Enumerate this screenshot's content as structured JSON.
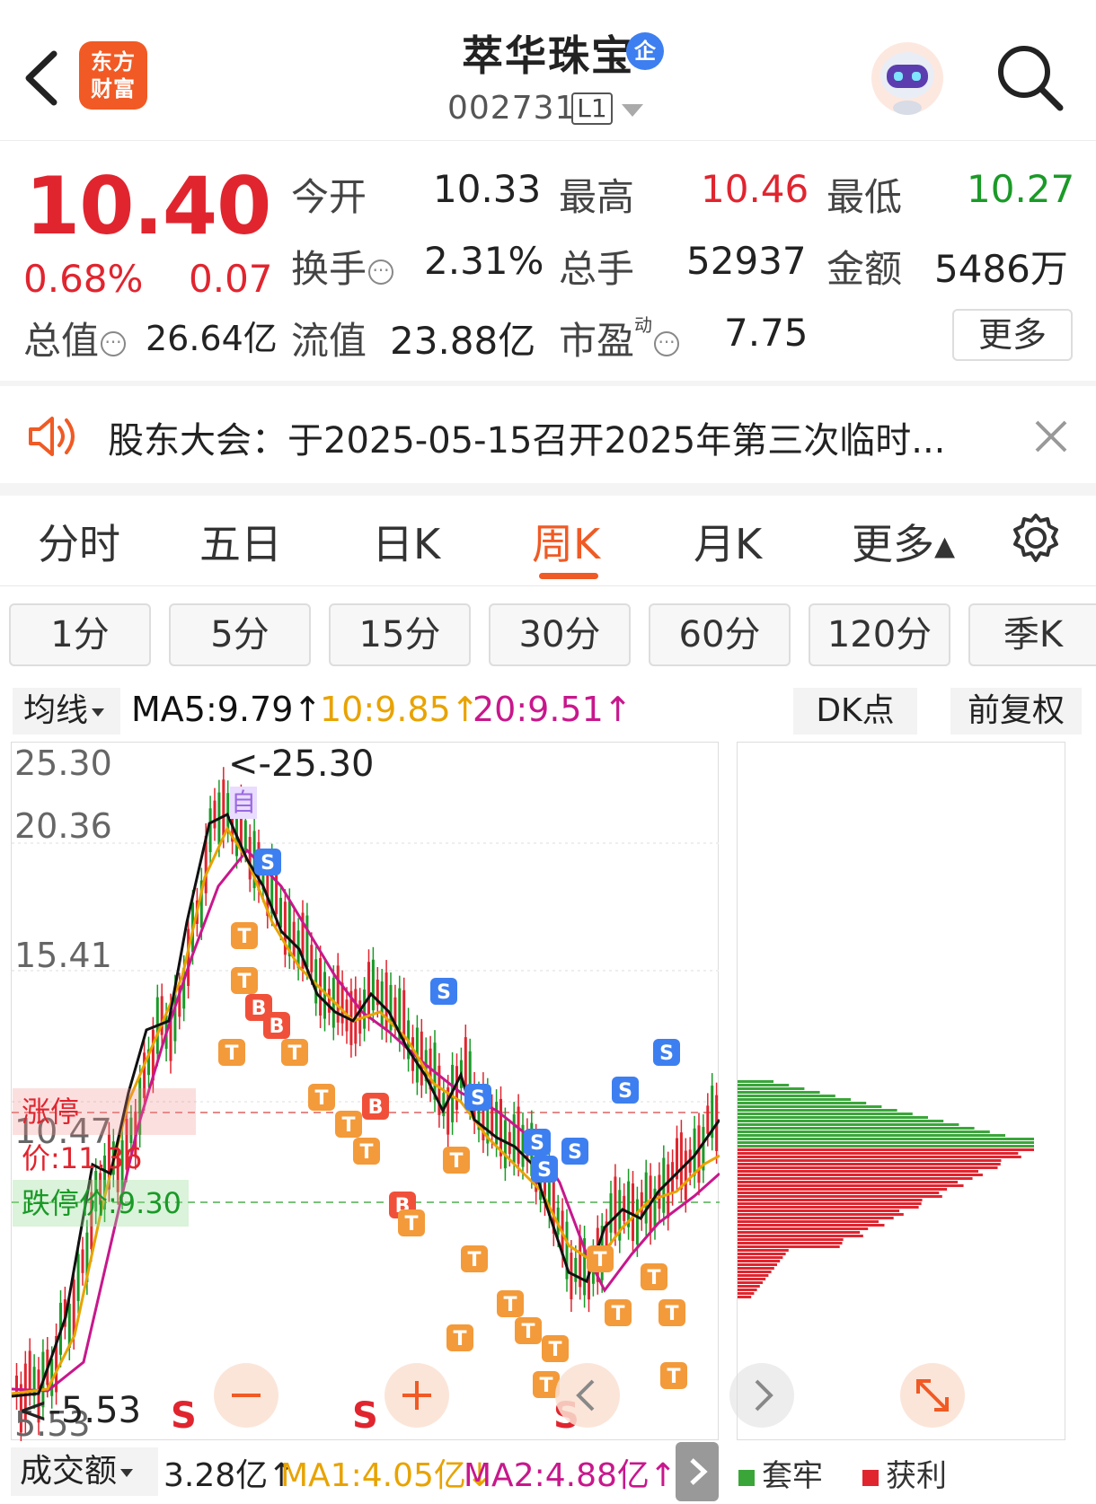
{
  "header": {
    "logo_text_line1": "东方",
    "logo_text_line2": "财富",
    "title": "萃华珠宝",
    "badge": "企",
    "code": "002731",
    "level": "L1"
  },
  "quote": {
    "price": "10.40",
    "change_pct": "0.68%",
    "change_val": "0.07",
    "open_label": "今开",
    "open": "10.33",
    "high_label": "最高",
    "high": "10.46",
    "low_label": "最低",
    "low": "10.27",
    "turnover_label": "换手",
    "turnover": "2.31%",
    "volume_label": "总手",
    "volume": "52937",
    "amount_label": "金额",
    "amount": "5486万",
    "mktcap_label": "总值",
    "mktcap": "26.64亿",
    "float_label": "流值",
    "float_cap": "23.88亿",
    "pe_label": "市盈",
    "pe_sup": "动",
    "pe": "7.75",
    "more_label": "更多"
  },
  "notice": {
    "text": "股东大会：于2025-05-15召开2025年第三次临时..."
  },
  "tabs": [
    {
      "label": "分时"
    },
    {
      "label": "五日"
    },
    {
      "label": "日K"
    },
    {
      "label": "周K"
    },
    {
      "label": "月K"
    },
    {
      "label": "更多▴"
    }
  ],
  "periods": [
    "1分",
    "5分",
    "15分",
    "30分",
    "60分",
    "120分",
    "季K"
  ],
  "ma_row": {
    "selector": "均线",
    "ma5": "MA5:9.79↑",
    "ma10": "10:9.85↑",
    "ma20": "20:9.51↑",
    "dk": "DK点",
    "adjust": "前复权"
  },
  "chart": {
    "y_labels": [
      "25.30",
      "20.36",
      "15.41",
      "10.47",
      "5.53"
    ],
    "limit_up": "涨停价:11.36",
    "limit_down": "跌停价:9.30",
    "max_marker": "<-25.30",
    "min_marker": "<-5.53",
    "self_tag": "自",
    "s_label": "S"
  },
  "volume_row": {
    "selector": "成交额",
    "vol": "3.28亿↑",
    "ma1": "MA1:4.05亿↓",
    "ma2": "MA2:4.88亿↑"
  },
  "legend": {
    "trapped": "套牢",
    "profit": "获利"
  },
  "colors": {
    "accent": "#f05a24",
    "up": "#e0252f",
    "down": "#1a9a27",
    "ma5": "#111111",
    "ma10": "#e8a300",
    "ma20": "#c8178c"
  }
}
